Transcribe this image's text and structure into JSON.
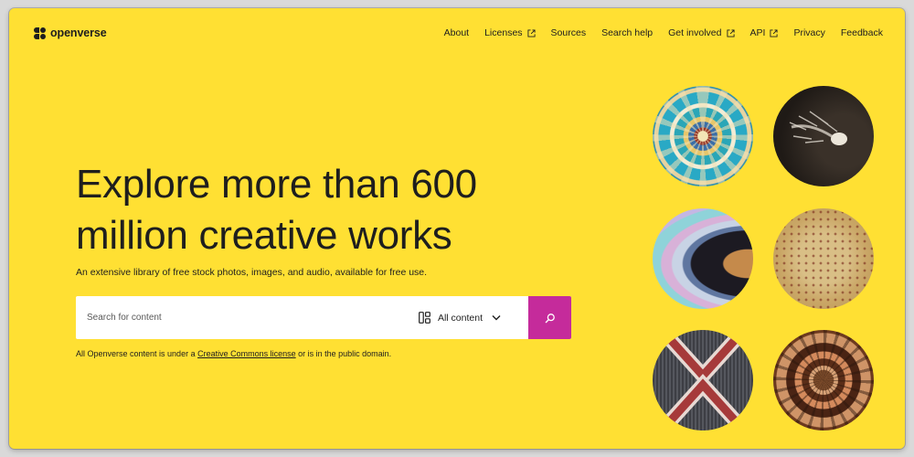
{
  "brand": {
    "name": "openverse"
  },
  "nav": {
    "items": [
      {
        "label": "About",
        "external": false
      },
      {
        "label": "Licenses",
        "external": true
      },
      {
        "label": "Sources",
        "external": false
      },
      {
        "label": "Search help",
        "external": false
      },
      {
        "label": "Get involved",
        "external": true
      },
      {
        "label": "API",
        "external": true
      },
      {
        "label": "Privacy",
        "external": false
      },
      {
        "label": "Feedback",
        "external": false
      }
    ]
  },
  "hero": {
    "headline_line1": "Explore more than 600",
    "headline_line2": "million creative works",
    "subtitle": "An extensive library of free stock photos, images, and audio, available for free use."
  },
  "search": {
    "placeholder": "Search for content",
    "content_type": "All content",
    "button_icon": "search-icon"
  },
  "license_note": {
    "before": "All Openverse content is under a ",
    "link": "Creative Commons license",
    "after": " or is in the public domain."
  },
  "colors": {
    "background": "#ffe033",
    "search_button": "#c52b9b",
    "text": "#1e1e1e"
  },
  "gallery": {
    "images": [
      "tile-mandala",
      "comet-drawing",
      "planet-rings",
      "star-map",
      "woven-textile",
      "circular-carving"
    ]
  }
}
